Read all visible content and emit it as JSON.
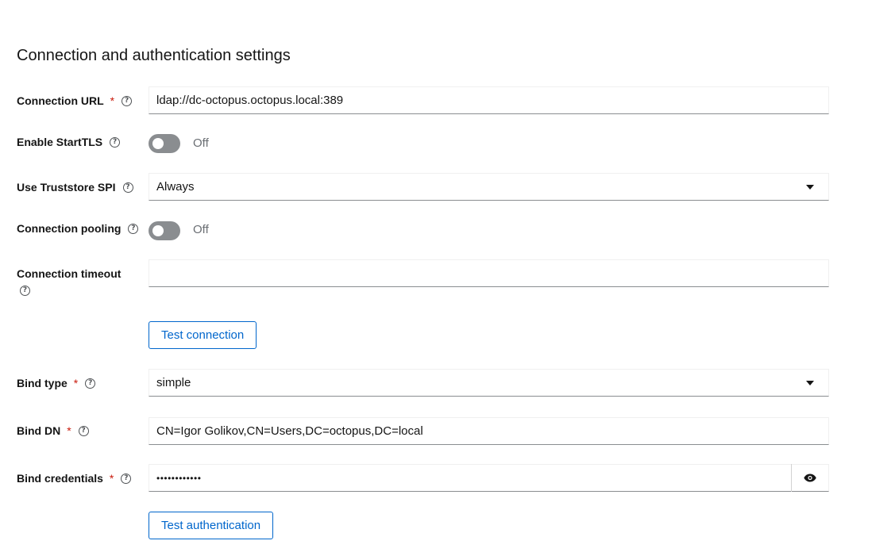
{
  "section": {
    "title": "Connection and authentication settings"
  },
  "fields": {
    "connection_url": {
      "label": "Connection URL",
      "required_mark": "*",
      "help": "?",
      "value": "ldap://dc-octopus.octopus.local:389"
    },
    "start_tls": {
      "label": "Enable StartTLS",
      "help": "?",
      "state": "Off"
    },
    "truststore": {
      "label": "Use Truststore SPI",
      "help": "?",
      "value": "Always"
    },
    "pooling": {
      "label": "Connection pooling",
      "help": "?",
      "state": "Off"
    },
    "timeout": {
      "label": "Connection timeout",
      "help": "?",
      "value": ""
    },
    "bind_type": {
      "label": "Bind type",
      "required_mark": "*",
      "help": "?",
      "value": "simple"
    },
    "bind_dn": {
      "label": "Bind DN",
      "required_mark": "*",
      "help": "?",
      "value": "CN=Igor Golikov,CN=Users,DC=octopus,DC=local"
    },
    "bind_credentials": {
      "label": "Bind credentials",
      "required_mark": "*",
      "help": "?",
      "value": "••••••••••••"
    }
  },
  "buttons": {
    "test_connection": "Test connection",
    "test_authentication": "Test authentication"
  },
  "icons": {
    "help": "question-circle-icon",
    "caret": "caret-down-icon",
    "reveal": "eye-icon"
  },
  "colors": {
    "accent": "#0066cc",
    "required": "#c9190b",
    "toggle_off": "#8a8d90"
  }
}
